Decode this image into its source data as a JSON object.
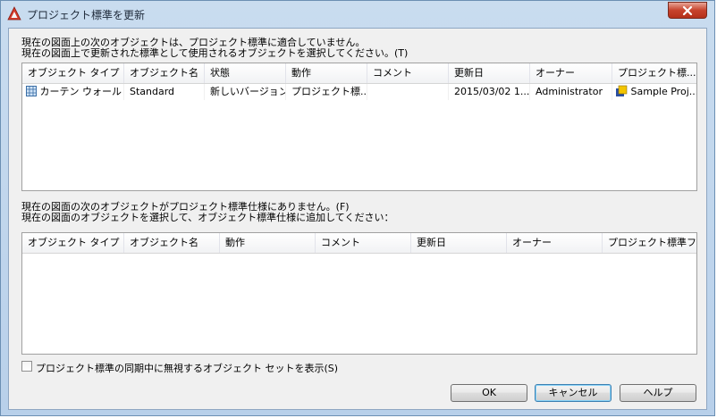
{
  "window": {
    "title": "プロジェクト標準を更新",
    "close_label": "✕"
  },
  "section1": {
    "instruction_line1": "現在の図面上の次のオブジェクトは、プロジェクト標準に適合していません。",
    "instruction_line2": "現在の図面上で更新された標準として使用されるオブジェクトを選択してください。(T)",
    "columns": [
      "オブジェクト タイプ",
      "オブジェクト名",
      "状態",
      "動作",
      "コメント",
      "更新日",
      "オーナー",
      "プロジェクト標..."
    ],
    "rows": [
      {
        "type": "カーテン ウォール ...",
        "name": "Standard",
        "state": "新しいバージョン",
        "action": "プロジェクト標...",
        "comment": "",
        "updated": "2015/03/02 1...",
        "owner": "Administrator",
        "project_std": "Sample Proj..."
      }
    ]
  },
  "section2": {
    "instruction_line1": "現在の図面の次のオブジェクトがプロジェクト標準仕様にありません。(F)",
    "instruction_line2": "現在の図面のオブジェクトを選択して、オブジェクト標準仕様に追加してください：",
    "columns": [
      "オブジェクト タイプ",
      "オブジェクト名",
      "動作",
      "コメント",
      "更新日",
      "オーナー",
      "プロジェクト標準フ..."
    ]
  },
  "checkbox_label": "プロジェクト標準の同期中に無視するオブジェクト セットを表示(S)",
  "checkbox_checked": false,
  "buttons": {
    "ok": "OK",
    "cancel": "キャンセル",
    "help": "ヘルプ"
  },
  "colors": {
    "title_bar": "#c9dcef",
    "close_button": "#c7422c",
    "dialog_bg": "#f0f0f0",
    "default_button_border": "#3c7fb1"
  }
}
